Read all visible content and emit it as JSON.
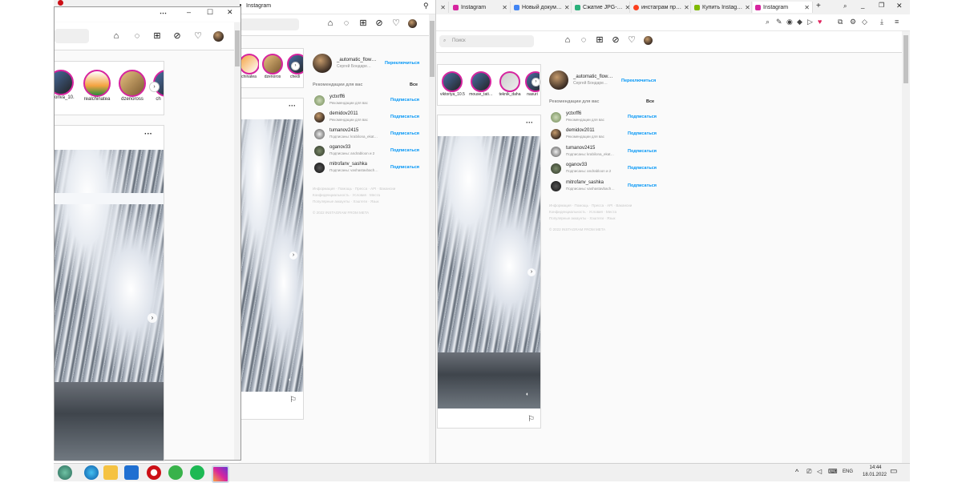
{
  "main_window": {
    "tabs": [
      {
        "label": "Instagram",
        "icon": "instagram-icon",
        "color": "#d6249f"
      },
      {
        "label": "Новый докум…",
        "icon": "docs-icon",
        "color": "#4285f4"
      },
      {
        "label": "Сжатие JPG-…",
        "icon": "compress-icon",
        "color": "#2ab07a"
      },
      {
        "label": "инстаграм пр…",
        "icon": "yandex-icon",
        "color": "#fc3f1d"
      },
      {
        "label": "Купить Instag…",
        "icon": "windows-icon",
        "color": "#7fba00"
      },
      {
        "label": "Instagram",
        "icon": "instagram-icon",
        "color": "#d6249f"
      }
    ],
    "search_placeholder": "Поиск",
    "stories": [
      {
        "name": "viktoriya_10.5"
      },
      {
        "name": "mouse_tati…"
      },
      {
        "name": "teknik_daha"
      },
      {
        "name": "nasuri"
      }
    ],
    "profile": {
      "username": "_automatic_flow…",
      "fullname": "Сергей Бондаре…",
      "switch": "Переключиться"
    },
    "suggestions_title": "Рекомендации для вас",
    "see_all": "Все",
    "suggestions": [
      {
        "user": "yctxrff6",
        "sub": "Рекомендации для вас",
        "follow": "Подписаться"
      },
      {
        "user": "demidov2011",
        "sub": "Рекомендации для вас",
        "follow": "Подписаться"
      },
      {
        "user": "tumanov2415",
        "sub": "Подписаны: krabilona_ekat…",
        "follow": "Подписаться"
      },
      {
        "user": "oganov33",
        "sub": "Подписаны: andrabloon и 2",
        "follow": "Подписаться"
      },
      {
        "user": "mitrofanv_sashka",
        "sub": "Подписаны: vashastavbach…",
        "follow": "Подписаться"
      }
    ],
    "footer_lines": [
      "Информация · Помощь · Пресса · API · Вакансии",
      "Конфиденциальность · Условия · Места",
      "Популярные аккаунты · Хэштеги · Язык"
    ],
    "copyright": "© 2022 INSTAGRAM FROM META"
  },
  "mid_window": {
    "title": "Instagram",
    "stories": [
      {
        "name": "chinatea"
      },
      {
        "name": "dzenoros"
      },
      {
        "name": "chedi"
      }
    ],
    "profile": {
      "username": "_automatic_flow…",
      "fullname": "Сергей Бондаре…",
      "switch": "Переключиться"
    },
    "suggestions_title": "Рекомендации для вас",
    "see_all": "Все",
    "suggestions": [
      {
        "user": "yctxrff6",
        "sub": "Рекомендации для вас",
        "follow": "Подписаться"
      },
      {
        "user": "demidov2011",
        "sub": "Рекомендации для вас",
        "follow": "Подписаться"
      },
      {
        "user": "tumanov2415",
        "sub": "Подписаны: krabilona_ekat…",
        "follow": "Подписаться"
      },
      {
        "user": "oganov33",
        "sub": "Подписаны: andrabloon и 2",
        "follow": "Подписаться"
      },
      {
        "user": "mitrofanv_sashka",
        "sub": "Подписаны: vashastavbach…",
        "follow": "Подписаться"
      }
    ],
    "footer_lines": [
      "Информация · Помощь · Пресса · API · Вакансии",
      "Конфиденциальность · Условия · Места",
      "Популярные аккаунты · Хэштеги · Язык"
    ],
    "copyright": "© 2022 INSTAGRAM FROM META"
  },
  "left_window": {
    "stories": [
      {
        "name": "oriva_10.5"
      },
      {
        "name": "realchinatea"
      },
      {
        "name": "dzenoross"
      },
      {
        "name": "ch"
      }
    ],
    "more": "···"
  },
  "taskbar": {
    "lang": "ENG",
    "time": "14:44",
    "date": "18.01.2022"
  },
  "colors": {
    "accent": "#0095f6",
    "story_ring": "#d6249f"
  }
}
